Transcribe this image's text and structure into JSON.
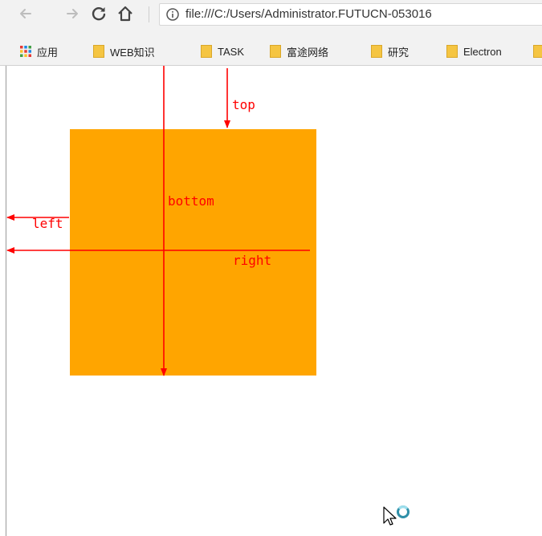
{
  "toolbar": {
    "url": "file:///C:/Users/Administrator.FUTUCN-053016",
    "back_icon": "back-arrow-icon",
    "forward_icon": "forward-arrow-icon",
    "reload_icon": "reload-icon",
    "home_icon": "home-icon",
    "info_icon": "info-icon"
  },
  "bookmarks": [
    {
      "label": "应用",
      "icon": "apps-grid-icon"
    },
    {
      "label": "WEB知识",
      "icon": "folder-icon"
    },
    {
      "label": "TASK",
      "icon": "folder-icon"
    },
    {
      "label": "富途网络",
      "icon": "folder-icon"
    },
    {
      "label": "研究",
      "icon": "folder-icon"
    },
    {
      "label": "Electron",
      "icon": "folder-icon"
    }
  ],
  "colors": {
    "box": "#ffa500",
    "annotation": "#ff0000",
    "folder": "#f5c542"
  },
  "annotations": {
    "top": "top",
    "bottom": "bottom",
    "left": "left",
    "right": "right"
  }
}
